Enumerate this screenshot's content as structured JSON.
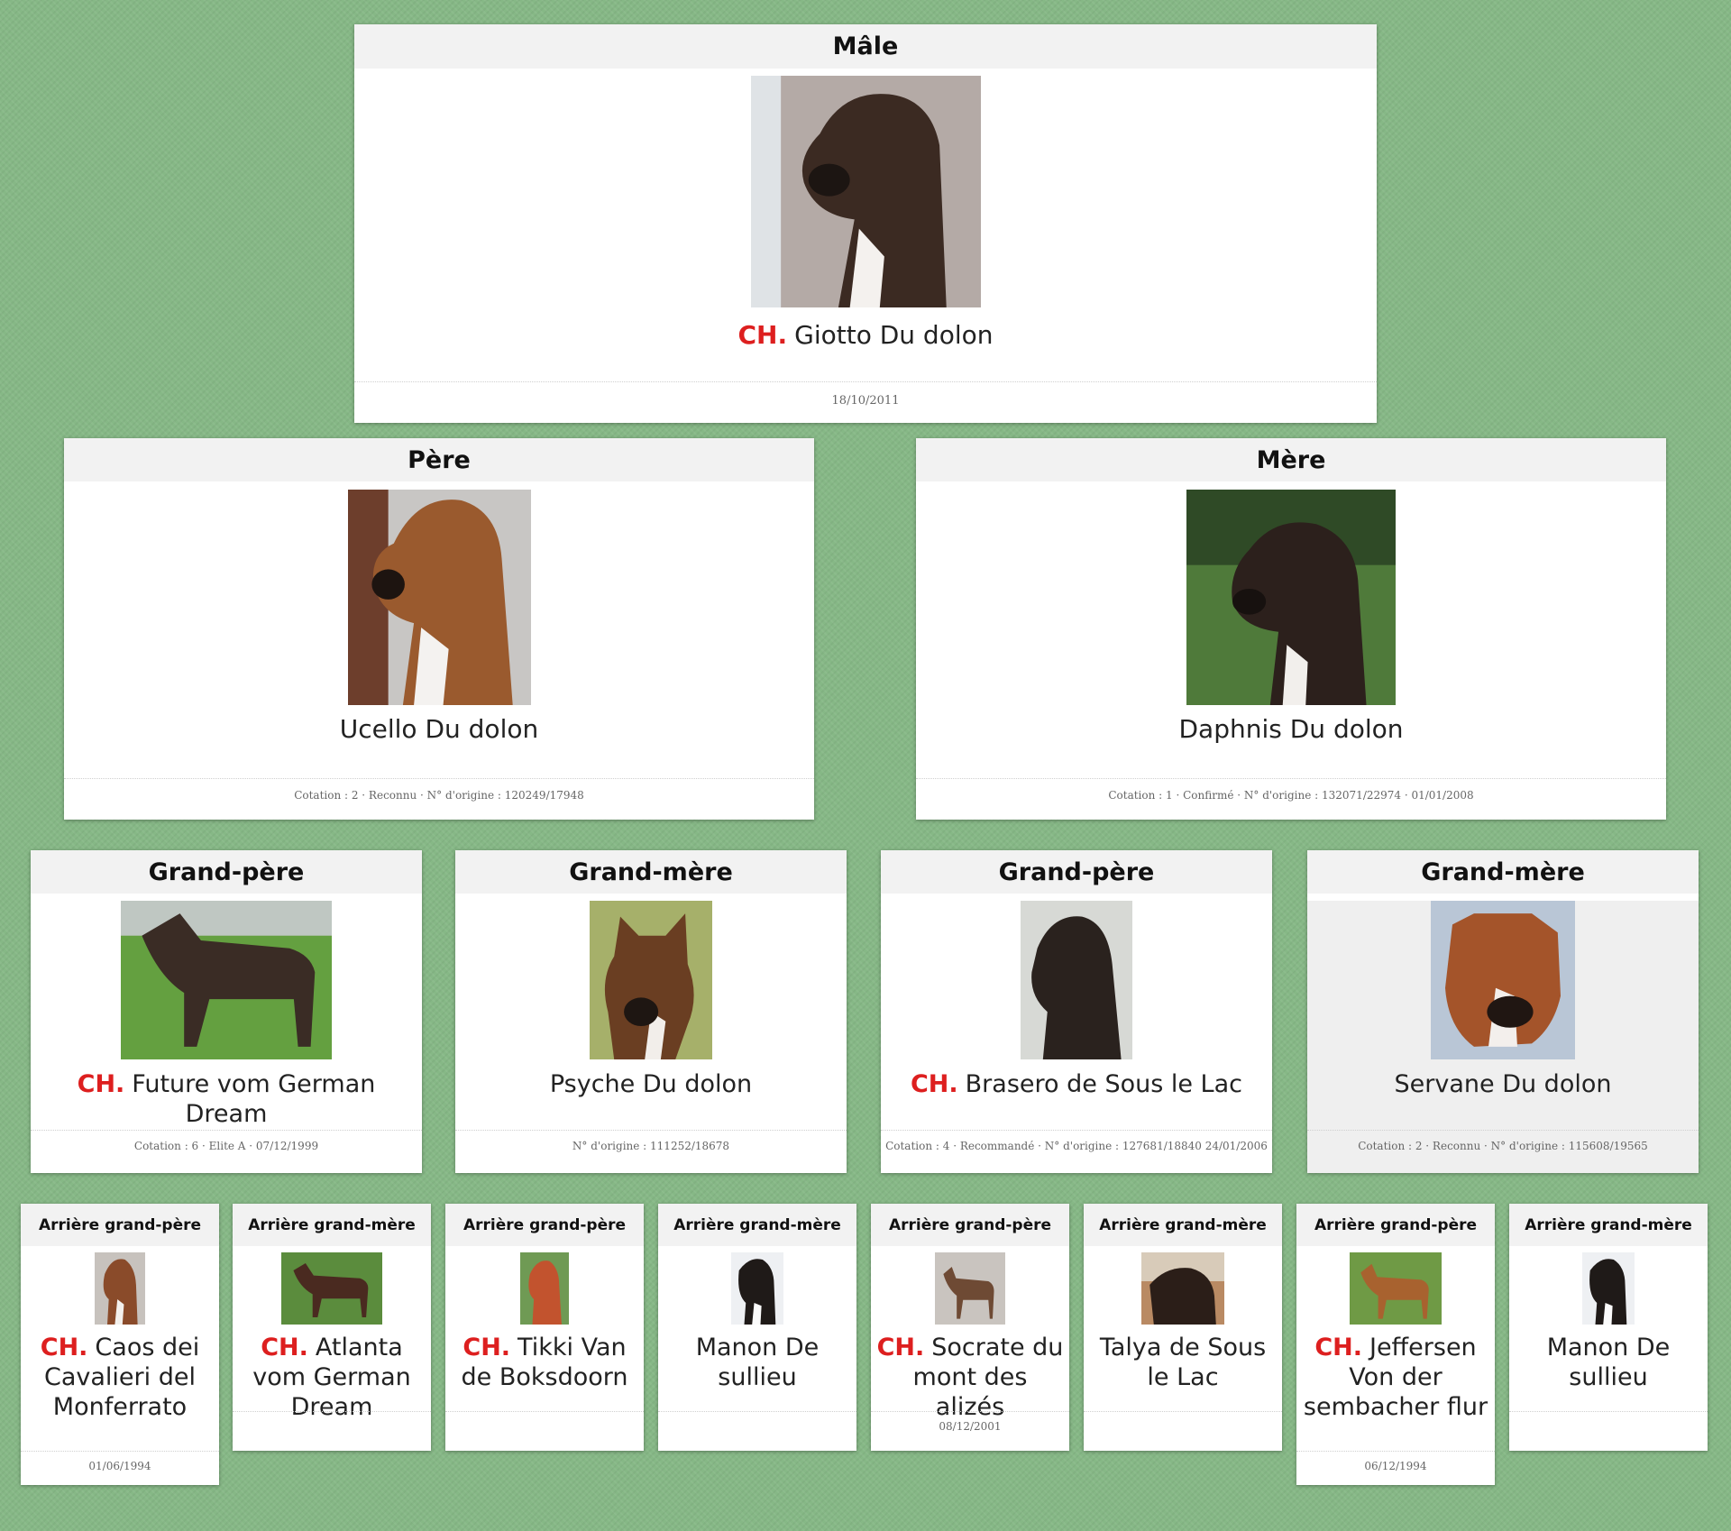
{
  "colors": {
    "background": "#86b886",
    "champion": "#dd1f1f",
    "card": "#ffffff",
    "header": "#f2f2f2"
  },
  "male": {
    "role": "Mâle",
    "title": "CH.",
    "name": "Giotto Du dolon",
    "info": "18/10/2011"
  },
  "father": {
    "role": "Père",
    "name": "Ucello Du dolon",
    "info": "Cotation : 2 · Reconnu · N° d'origine : 120249/17948"
  },
  "mother": {
    "role": "Mère",
    "name": "Daphnis Du dolon",
    "info": "Cotation : 1 · Confirmé · N° d'origine : 132071/22974 · 01/01/2008"
  },
  "grandparents": [
    {
      "role": "Grand-père",
      "title": "CH.",
      "name": "Future vom German Dream",
      "info": "Cotation : 6 · Elite A · 07/12/1999"
    },
    {
      "role": "Grand-mère",
      "name": "Psyche Du dolon",
      "info": "N° d'origine : 111252/18678"
    },
    {
      "role": "Grand-père",
      "title": "CH.",
      "name": "Brasero de Sous le Lac",
      "info": "Cotation : 4 · Recommandé · N° d'origine : 127681/18840 24/01/2006"
    },
    {
      "role": "Grand-mère",
      "name": "Servane Du dolon",
      "info": "Cotation : 2 · Reconnu · N° d'origine : 115608/19565"
    }
  ],
  "great_grandparents": [
    {
      "role": "Arrière grand-père",
      "title": "CH.",
      "name": "Caos dei Cavalieri del Monferrato",
      "info": "01/06/1994"
    },
    {
      "role": "Arrière grand-mère",
      "title": "CH.",
      "name": "Atlanta vom German Dream",
      "info": ""
    },
    {
      "role": "Arrière grand-père",
      "title": "CH.",
      "name": "Tikki Van de Boksdoorn",
      "info": ""
    },
    {
      "role": "Arrière grand-mère",
      "name": "Manon De sullieu",
      "info": ""
    },
    {
      "role": "Arrière grand-père",
      "title": "CH.",
      "name": "Socrate du mont des alizés",
      "info": "08/12/2001"
    },
    {
      "role": "Arrière grand-mère",
      "name": "Talya de Sous le Lac",
      "info": ""
    },
    {
      "role": "Arrière grand-père",
      "title": "CH.",
      "name": "Jeffersen Von der sembacher flur",
      "info": "06/12/1994"
    },
    {
      "role": "Arrière grand-mère",
      "name": "Manon De sullieu",
      "info": ""
    }
  ]
}
